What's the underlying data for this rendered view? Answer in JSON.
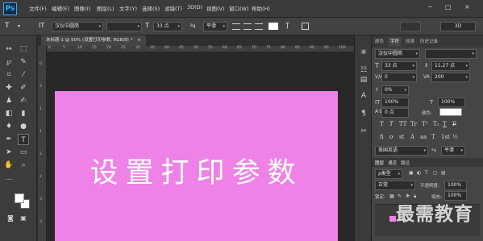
{
  "app": {
    "logo": "Ps"
  },
  "menus": [
    "文件(F)",
    "编辑(E)",
    "图像(I)",
    "图层(L)",
    "文字(Y)",
    "选择(S)",
    "滤镜(T)",
    "3D(D)",
    "视图(V)",
    "窗口(W)",
    "帮助(H)"
  ],
  "window": {
    "minimize": "−",
    "maximize": "□",
    "close": "×"
  },
  "options": {
    "tool_icon": "T",
    "orient_icon": "IT",
    "font_family": "汉仪中圆简",
    "font_size": "33 点",
    "aa_label": "ªa",
    "aa_mode": "平滑",
    "mode_3d": "3D"
  },
  "tab": {
    "title": "未标题-1 @ 50% (设置打印参数, RGB/8) *",
    "close": "×"
  },
  "ruler": {
    "h": [
      "0",
      "5",
      "10",
      "15",
      "20",
      "25",
      "30",
      "35",
      "40",
      "45",
      "50",
      "55",
      "60",
      "65",
      "70",
      "75",
      "80",
      "85",
      "90",
      "95",
      "100"
    ],
    "v": [
      "0",
      "5",
      "1",
      "1",
      "2",
      "2",
      "3",
      "3"
    ]
  },
  "canvas": {
    "text": "设置打印参数",
    "color": "#ee82e6"
  },
  "panel": {
    "tabs": [
      "颜色",
      "字符",
      "段落",
      "历史记录"
    ],
    "active_tab": "字符",
    "font_family": "汉仪中圆简",
    "font_size": "33 点",
    "leading": "11.27 点",
    "kerning": "0",
    "tracking": "200",
    "scale_pct": "0%",
    "vert_scale": "100%",
    "horiz_scale": "100%",
    "baseline": "0 点",
    "color_label": "颜色:",
    "styles": [
      "T",
      "T",
      "TT",
      "Tr",
      "T¹",
      "T₁",
      "T",
      "F"
    ],
    "language": "美国英语",
    "aa_label": "ªa",
    "aa_mode": "平滑",
    "layers_tabs": [
      "图层",
      "通道",
      "路径"
    ],
    "filter_label": "ρ类型",
    "blend_mode": "正常",
    "opacity_label": "不透明度:",
    "opacity": "100%",
    "lock_label": "锁定:",
    "fill_label": "填充:",
    "fill": "100%"
  },
  "watermark": "最需教育"
}
